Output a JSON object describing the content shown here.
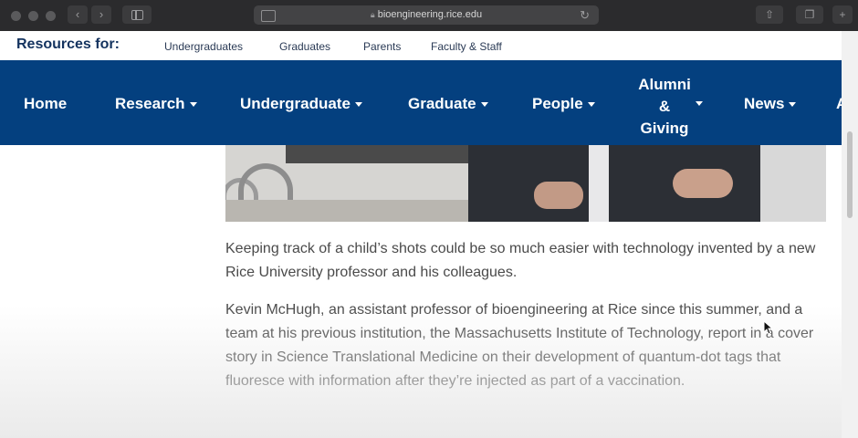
{
  "browser": {
    "url": "bioengineering.rice.edu"
  },
  "resources": {
    "title": "Resources for:",
    "links": [
      "Undergraduates",
      "Graduates",
      "Parents",
      "Faculty & Staff"
    ]
  },
  "nav": {
    "items": [
      {
        "label": "Home"
      },
      {
        "label": "Research"
      },
      {
        "label": "Undergraduate"
      },
      {
        "label": "Graduate"
      },
      {
        "label": "People"
      },
      {
        "label_lines": [
          "Alumni",
          "&",
          "Giving"
        ]
      },
      {
        "label": "News"
      }
    ],
    "partial": "A"
  },
  "article": {
    "paragraphs": [
      "Keeping track of a child’s shots could be so much easier with technology invented by a new Rice University professor and his colleagues.",
      "Kevin McHugh, an assistant professor of bioengineering at Rice since this summer, and a team at his previous institution, the Massachusetts Institute of Technology, report in a cover story in Science Translational Medicine on their development of quantum-dot tags that fluoresce with information after they’re injected as part of a vaccination."
    ]
  },
  "colors": {
    "nav_bg": "#04407f",
    "resources_title": "#14335f",
    "chrome_bg": "#2b2b2d"
  }
}
